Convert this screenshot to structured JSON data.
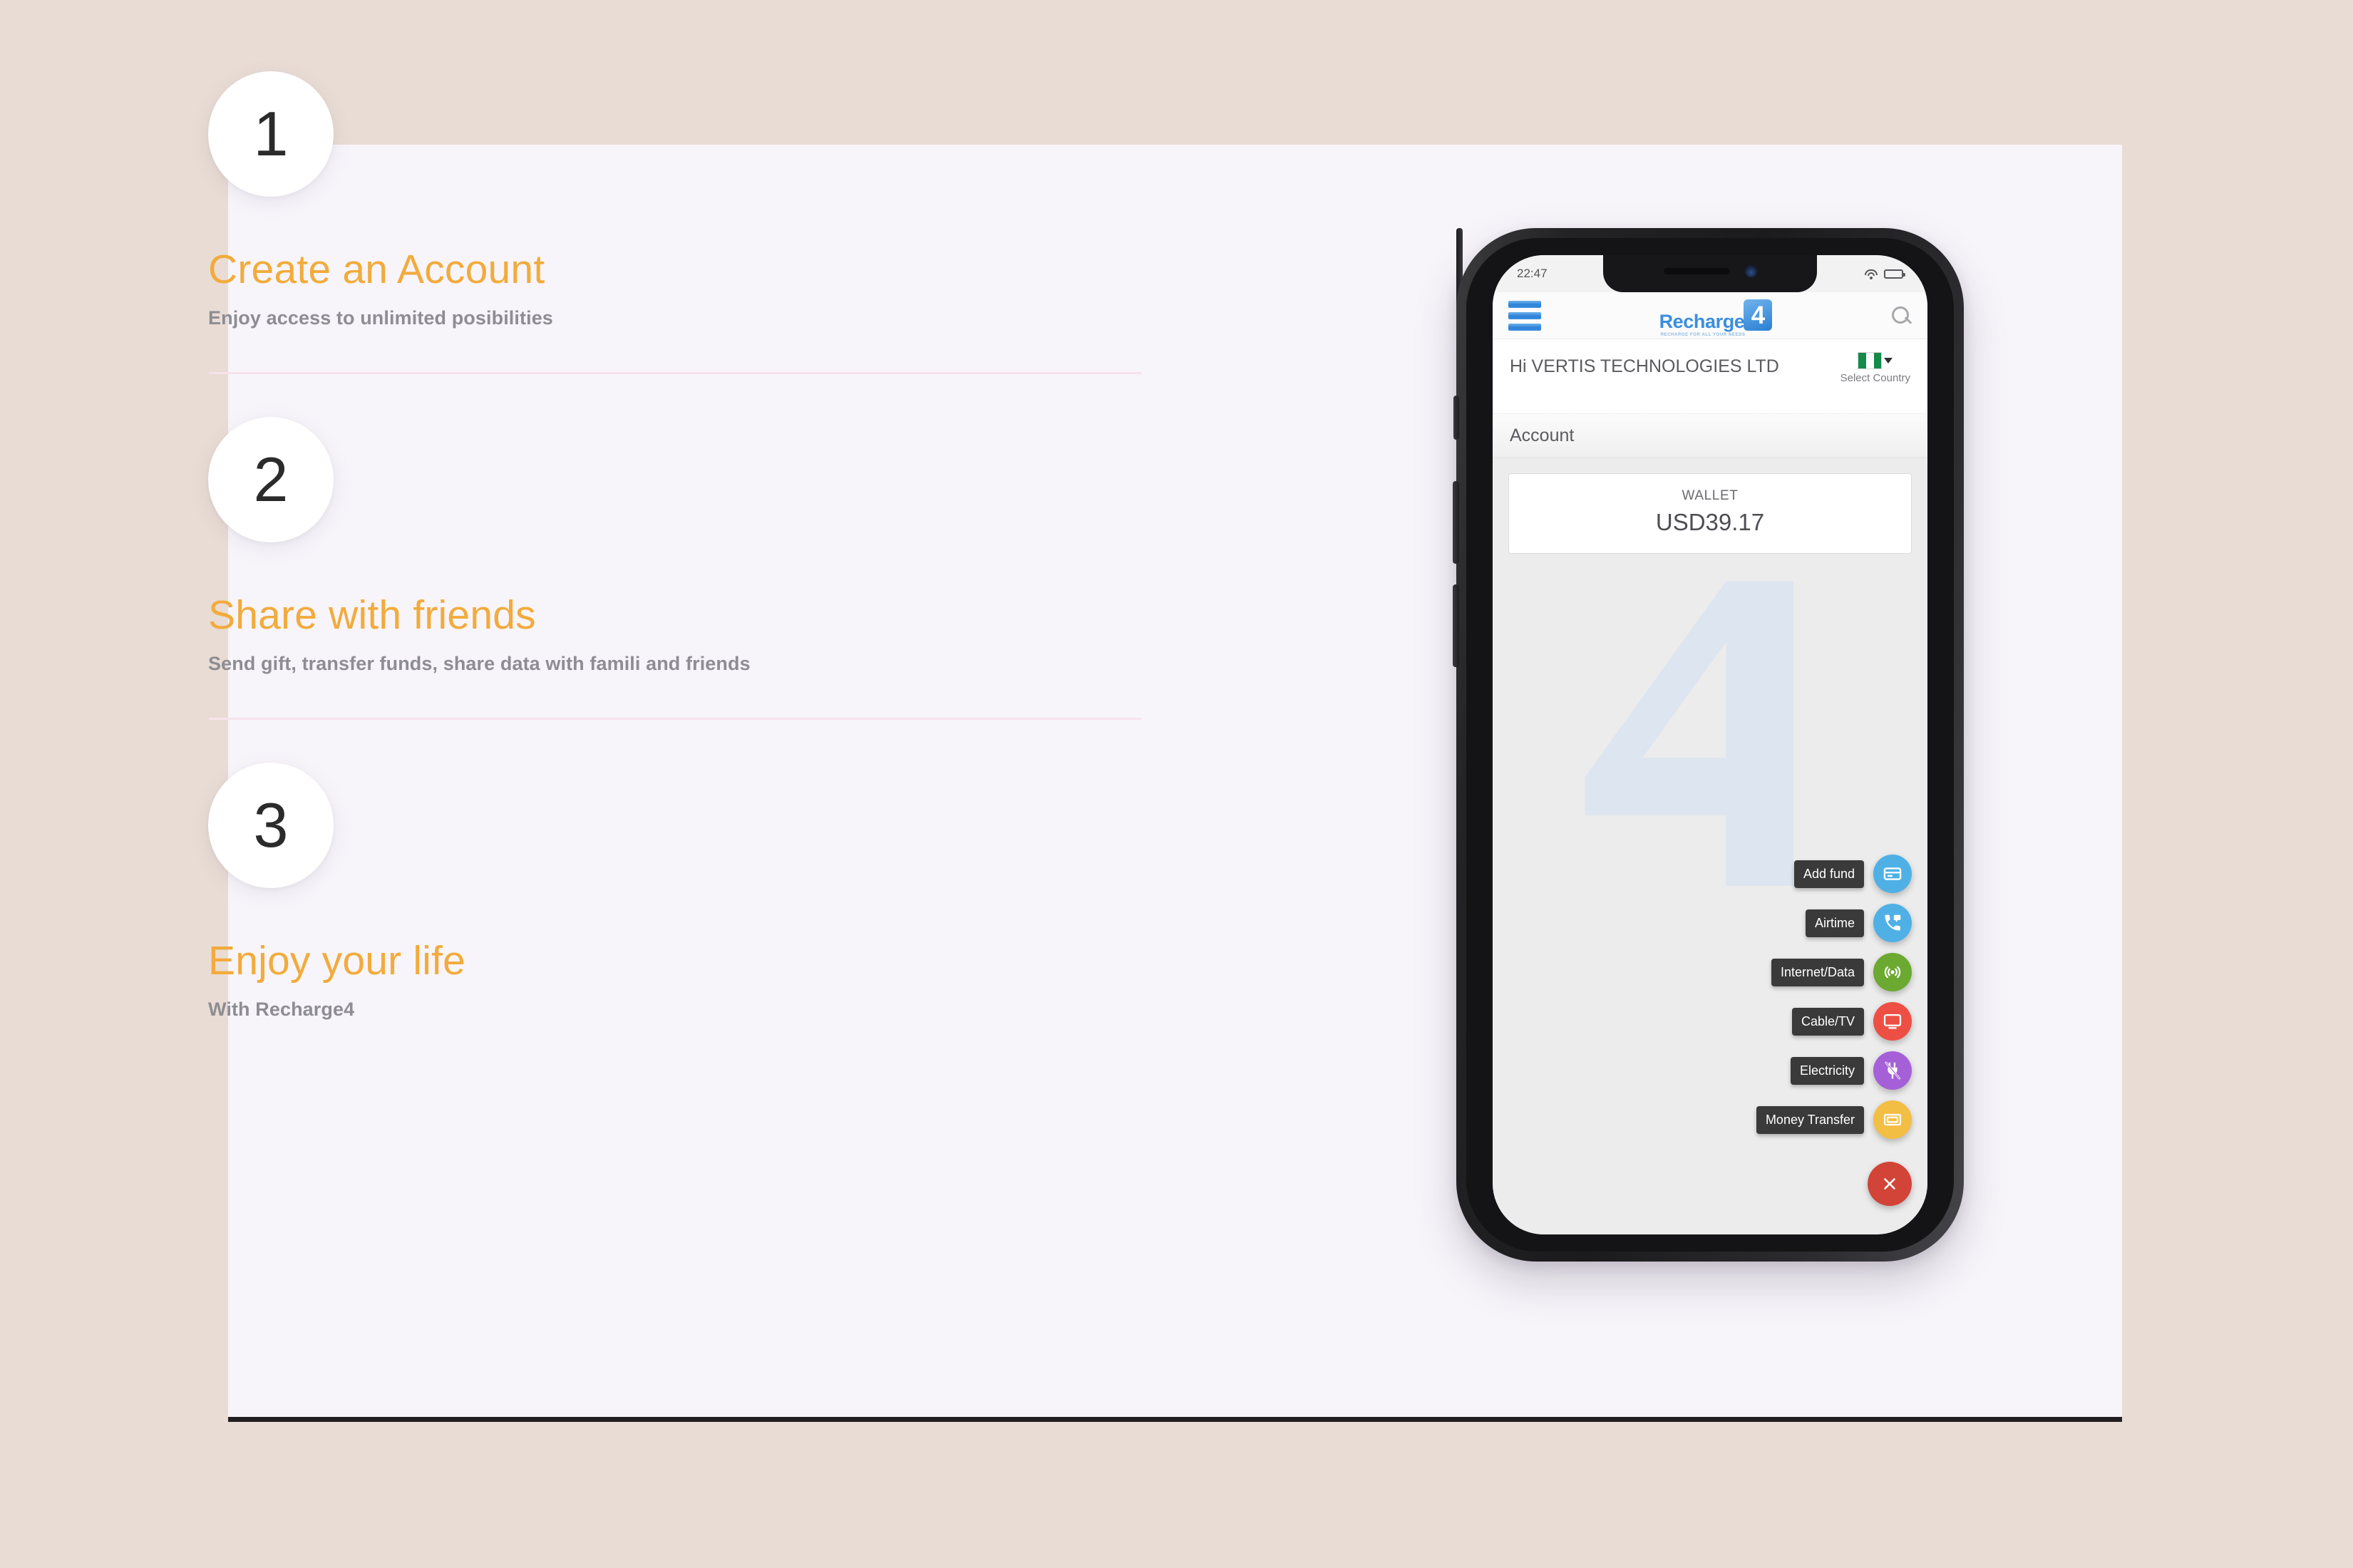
{
  "page": {
    "background_color": "#e9dcd4",
    "card_background_color": "#f7f5fa",
    "accent_color": "#f2ab3c",
    "muted_text_color": "#8d8d93"
  },
  "steps": [
    {
      "number": "1",
      "title": "Create an Account",
      "description": "Enjoy access to unlimited posibilities"
    },
    {
      "number": "2",
      "title": "Share with friends",
      "description": "Send gift, transfer funds, share data with famili and friends"
    },
    {
      "number": "3",
      "title": "Enjoy your life",
      "description": "With Recharge4"
    }
  ],
  "phone": {
    "status_bar": {
      "time": "22:47",
      "wifi_icon": "wifi-icon",
      "battery_icon": "battery-icon"
    },
    "app_bar": {
      "menu_icon": "hamburger-menu-icon",
      "logo_word": "Recharge",
      "logo_mark": "4",
      "logo_tagline": "RECHARGE FOR ALL YOUR NEEDS",
      "search_icon": "search-icon"
    },
    "greeting": {
      "text": "Hi VERTIS TECHNOLOGIES LTD",
      "country_flag": "nigeria-flag-icon",
      "country_caret": "chevron-down-icon",
      "country_label": "Select Country"
    },
    "section_title": "Account",
    "wallet": {
      "label": "WALLET",
      "amount": "USD39.17"
    },
    "watermark": "recharge4-logo-watermark",
    "fab_menu": {
      "items": [
        {
          "label": "Add fund",
          "icon": "credit-card-icon",
          "color": "#4FB0E6"
        },
        {
          "label": "Airtime",
          "icon": "phone-call-icon",
          "color": "#4FB0E6"
        },
        {
          "label": "Internet/Data",
          "icon": "broadcast-icon",
          "color": "#6CA931"
        },
        {
          "label": "Cable/TV",
          "icon": "monitor-tv-icon",
          "color": "#EE4F44"
        },
        {
          "label": "Electricity",
          "icon": "plug-off-icon",
          "color": "#A560D8"
        },
        {
          "label": "Money Transfer",
          "icon": "money-bill-icon",
          "color": "#F3BE44"
        }
      ],
      "close": {
        "icon": "close-icon",
        "color": "#D14437"
      }
    }
  }
}
